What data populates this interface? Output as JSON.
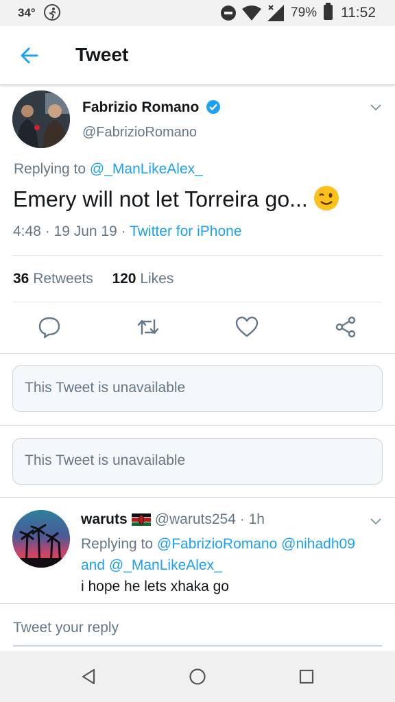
{
  "status_bar": {
    "temperature": "34°",
    "battery": "79%",
    "time": "11:52",
    "icons": [
      "running-icon",
      "dnd-icon",
      "wifi-icon",
      "cell-signal-icon",
      "battery-icon"
    ]
  },
  "header": {
    "title": "Tweet",
    "back_icon": "arrow-left-icon"
  },
  "main_tweet": {
    "author_name": "Fabrizio Romano",
    "author_handle": "@FabrizioRomano",
    "replying_prefix": "Replying to ",
    "replying_to": "@_ManLikeAlex_",
    "text": "Emery will not let Torreira go...",
    "emoji": "wink-emoji",
    "time": "4:48",
    "date": "19 Jun 19",
    "source": "Twitter for iPhone",
    "retweets_count": "36",
    "retweets_label": "Retweets",
    "likes_count": "120",
    "likes_label": "Likes",
    "actions": [
      "reply-icon",
      "retweet-icon",
      "like-icon",
      "share-icon"
    ]
  },
  "unavailable": [
    {
      "text": "This Tweet is unavailable"
    },
    {
      "text": "This Tweet is unavailable"
    }
  ],
  "reply_tweet": {
    "author_name": "waruts",
    "author_handle": "@waruts254",
    "age": "1h",
    "replying_prefix": "Replying to ",
    "mention_1": "@FabrizioRomano",
    "mention_2": "@nihadh09",
    "and_word": "and",
    "mention_3": "@_ManLikeAlex_",
    "text": "i hope he lets xhaka go"
  },
  "compose": {
    "placeholder": "Tweet your reply"
  },
  "colors": {
    "accent": "#1da1f2",
    "secondary_text": "#657786",
    "primary_text": "#14171a"
  }
}
